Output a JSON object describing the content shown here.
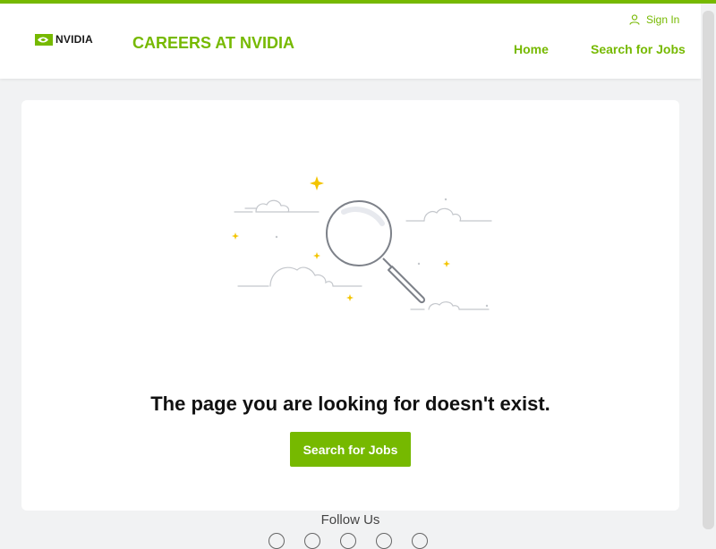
{
  "header": {
    "logo_text": "NVIDIA",
    "site_title": "CAREERS AT NVIDIA",
    "signin_label": "Sign In",
    "nav": {
      "home": "Home",
      "search_jobs": "Search for Jobs"
    }
  },
  "main": {
    "message": "The page you are looking for doesn't exist.",
    "cta_label": "Search for Jobs"
  },
  "footer": {
    "follow_label": "Follow Us",
    "social_icons": [
      "social-icon",
      "social-icon",
      "social-icon",
      "social-icon",
      "social-icon"
    ]
  },
  "colors": {
    "brand": "#76b900",
    "background": "#f1f2f3",
    "text": "#111111"
  },
  "icons": {
    "logo": "nvidia-eye-icon",
    "signin": "user-icon",
    "illustration": "magnifying-glass-icon"
  }
}
